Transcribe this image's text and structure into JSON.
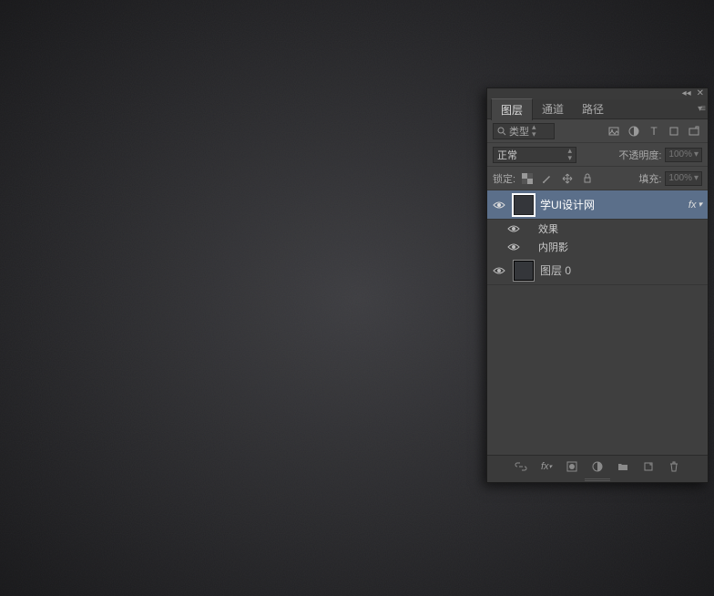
{
  "panel": {
    "tabs": {
      "layers": "图层",
      "channels": "通道",
      "paths": "路径"
    },
    "filter": {
      "search_icon": "search-icon",
      "kind_label": "类型"
    },
    "blend": {
      "mode": "正常",
      "opacity_label": "不透明度:",
      "opacity_value": "100%"
    },
    "lock": {
      "label": "锁定:",
      "fill_label": "填充:",
      "fill_value": "100%"
    },
    "layers": [
      {
        "name": "学UI设计网",
        "selected": true,
        "has_fx": true,
        "effects_label": "效果",
        "inner_shadow_label": "内阴影"
      },
      {
        "name": "图层 0",
        "selected": false,
        "has_fx": false
      }
    ],
    "fx_text": "fx"
  }
}
